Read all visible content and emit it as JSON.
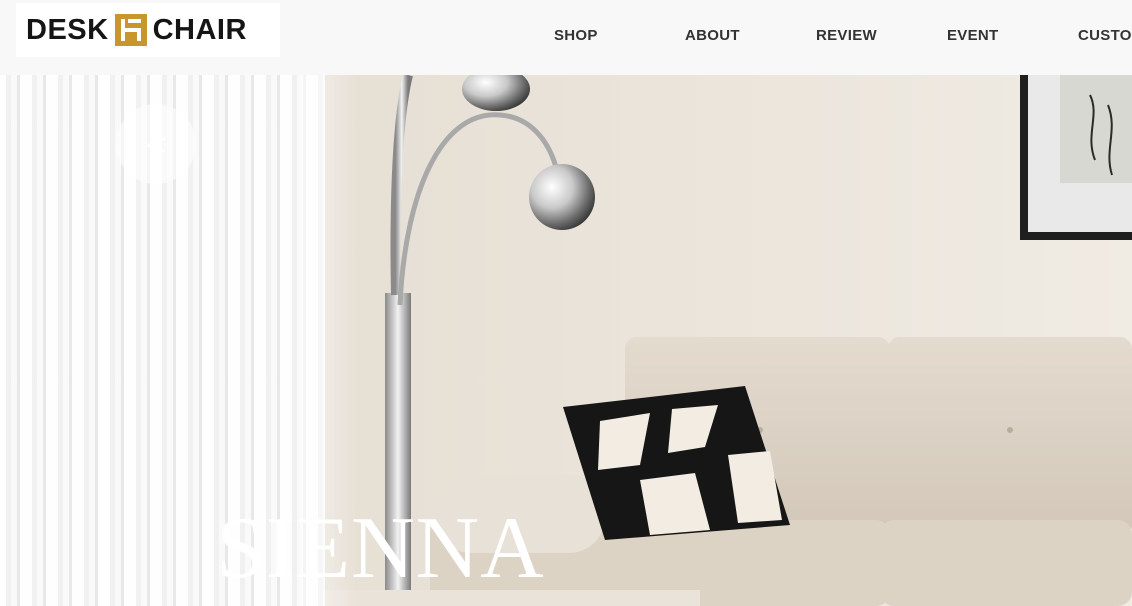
{
  "brand": {
    "word1": "DESK",
    "word2": "CHAIR",
    "accent_color": "#C9962E"
  },
  "nav": {
    "items": [
      {
        "label": "SHOP"
      },
      {
        "label": "ABOUT"
      },
      {
        "label": "REVIEW"
      },
      {
        "label": "EVENT"
      },
      {
        "label": "CUSTON"
      }
    ]
  },
  "hero": {
    "title": "SIENNA",
    "prev_icon": "chevron-left-icon",
    "prev_glyph": "<"
  }
}
